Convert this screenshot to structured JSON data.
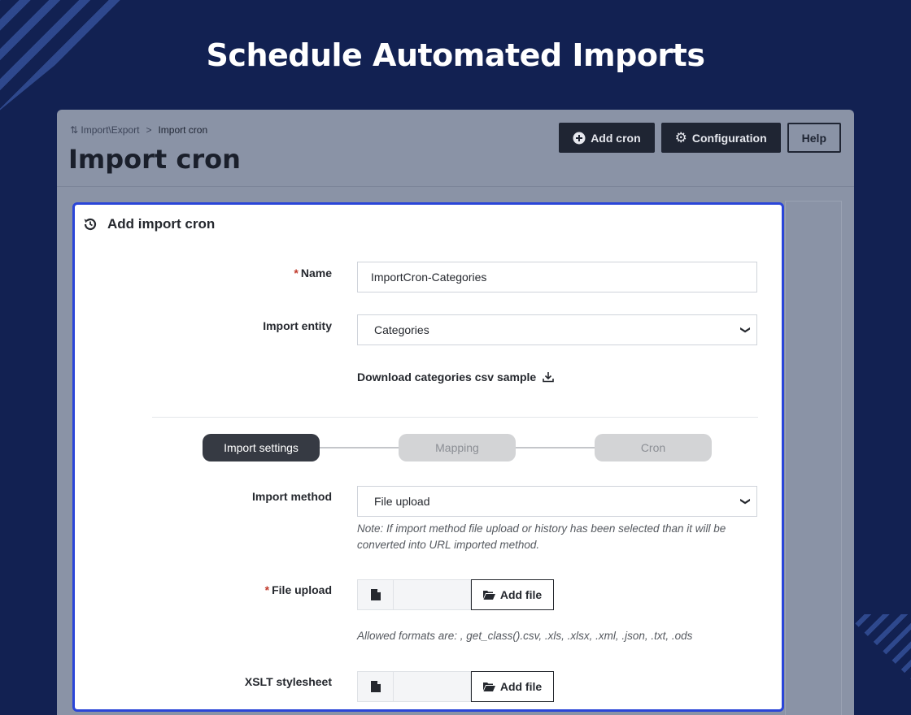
{
  "banner": {
    "title": "Schedule Automated Imports"
  },
  "header": {
    "breadcrumb": [
      "Import\\Export",
      "Import cron"
    ],
    "breadcrumb_sep": ">",
    "title": "Import cron",
    "buttons": {
      "add_cron": "Add cron",
      "configuration": "Configuration",
      "help": "Help"
    }
  },
  "form": {
    "title": "Add import cron",
    "name": {
      "label": "Name",
      "required_mark": "*",
      "value": "ImportCron-Categories"
    },
    "entity": {
      "label": "Import entity",
      "value": "Categories"
    },
    "download_link": "Download categories csv sample",
    "steps": [
      "Import settings",
      "Mapping",
      "Cron"
    ],
    "active_step": 0,
    "method": {
      "label": "Import method",
      "value": "File upload",
      "note": "Note: If import method file upload or history has been selected than it will be converted into URL imported method."
    },
    "file_upload": {
      "label": "File upload",
      "required_mark": "*",
      "button": "Add file",
      "formats_note": "Allowed formats are: , get_class().csv, .xls, .xlsx, .xml, .json, .txt, .ods"
    },
    "xslt": {
      "label": "XSLT stylesheet",
      "button": "Add file"
    }
  },
  "colors": {
    "background": "#122152",
    "card_border": "#2a45d8",
    "dark_button": "#1f2533",
    "required": "#c0392b"
  },
  "icons": [
    "history-icon",
    "plus-circle-icon",
    "gears-icon",
    "download-icon",
    "file-icon",
    "folder-open-icon",
    "chevron-down-icon"
  ]
}
